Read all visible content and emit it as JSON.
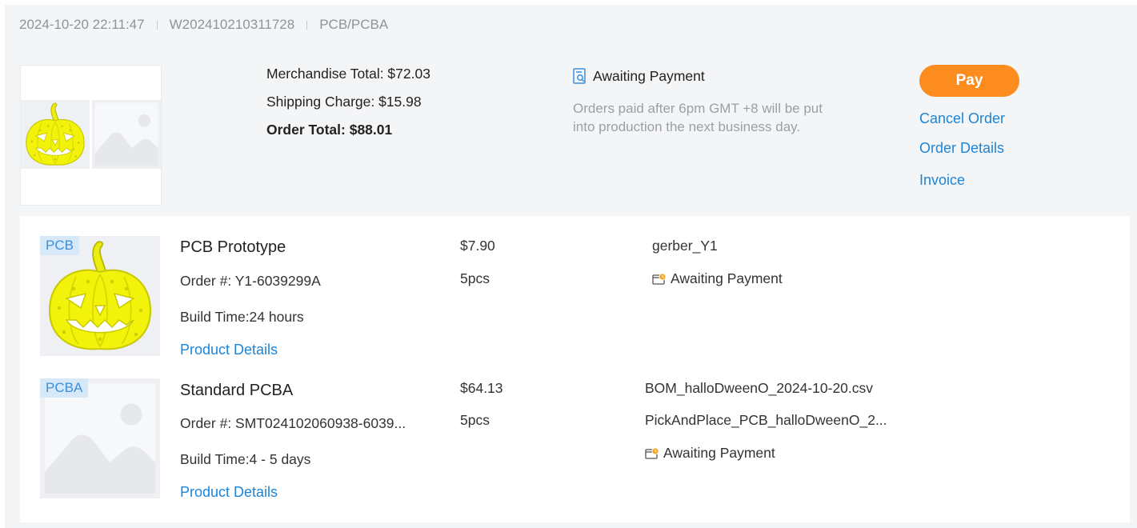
{
  "order": {
    "datetime": "2024-10-20 22:11:47",
    "number": "W202410210311728",
    "category": "PCB/PCBA"
  },
  "summary": {
    "merchandise_total": "Merchandise Total: $72.03",
    "shipping_charge": "Shipping Charge: $15.98",
    "order_total": "Order Total: $88.01"
  },
  "status": {
    "label": "Awaiting Payment",
    "icon": "search-document-icon",
    "note": "Orders paid after 6pm GMT +8 will be put into production the next business day."
  },
  "actions": {
    "pay": "Pay",
    "cancel": "Cancel Order",
    "details": "Order Details",
    "invoice": "Invoice"
  },
  "items": [
    {
      "tag": "PCB",
      "title": "PCB Prototype",
      "order_no": "Order #: Y1-6039299A",
      "build_time": "Build Time:24 hours",
      "link": "Product Details",
      "price": "$7.90",
      "qty": "5pcs",
      "files": [
        "gerber_Y1"
      ],
      "status": "Awaiting Payment",
      "image": "pumpkin-pcb-image"
    },
    {
      "tag": "PCBA",
      "title": "Standard PCBA",
      "order_no": "Order #: SMT024102060938-6039...",
      "build_time": "Build Time:4 - 5 days",
      "link": "Product Details",
      "price": "$64.13",
      "qty": "5pcs",
      "files": [
        "BOM_halloDweenO_2024-10-20.csv",
        "PickAndPlace_PCB_halloDweenO_2..."
      ],
      "status": "Awaiting Payment",
      "image": "image-placeholder-icon"
    }
  ],
  "colors": {
    "accent": "#fb8c1d",
    "link": "#1d85d7",
    "card_bg": "#f4f5f7",
    "pcb_yellow": "#f2f20a",
    "tag_bg": "#d7e8f8"
  }
}
